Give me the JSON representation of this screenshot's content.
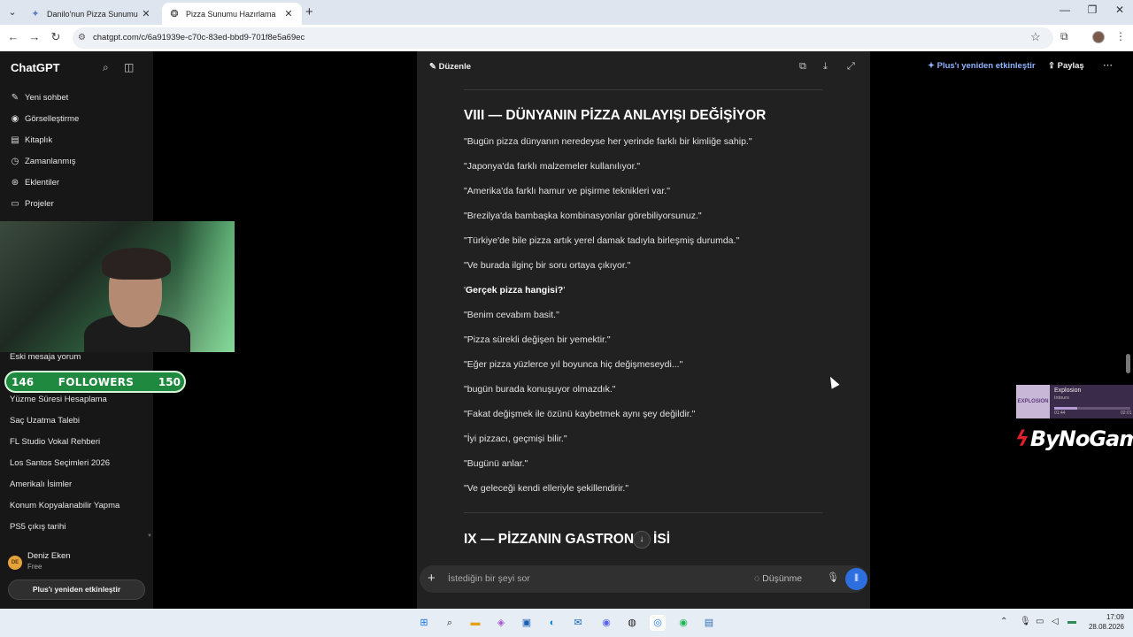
{
  "browser": {
    "tabs": [
      {
        "title": "Danilo'nun Pizza Sunumu - Gem",
        "close": "✕"
      },
      {
        "title": "Pizza Sunumu Hazırlama",
        "close": "✕"
      }
    ],
    "new_tab": "+",
    "url": "chatgpt.com/c/6a91939e-c70c-83ed-bbd9-701f8e5a69ec"
  },
  "sidebar": {
    "brand": "ChatGPT",
    "nav": [
      {
        "label": "Yeni sohbet",
        "icon": "edit-icon"
      },
      {
        "label": "Görselleştirme",
        "icon": "image-icon"
      },
      {
        "label": "Kitaplık",
        "icon": "library-icon"
      },
      {
        "label": "Zamanlanmış",
        "icon": "clock-icon"
      },
      {
        "label": "Eklentiler",
        "icon": "plugin-icon"
      },
      {
        "label": "Projeler",
        "icon": "folder-icon"
      }
    ],
    "chats": [
      "Eski mesaja yorum",
      "Yüzme Süresi Hesaplama",
      "Saç Uzatma Talebi",
      "FL Studio Vokal Rehberi",
      "Los Santos Seçimleri 2026",
      "Amerikalı İsimler",
      "Konum Kopyalanabilir Yapma",
      "PS5 çıkış tarihi"
    ],
    "user": {
      "initials": "DE",
      "name": "Deniz Eken",
      "plan": "Free"
    },
    "upgrade_button": "Plus'ı yeniden etkinleştir"
  },
  "overlay": {
    "followers_current": "146",
    "followers_label": "FOLLOWERS",
    "followers_goal": "150",
    "music": {
      "track": "Explosion",
      "artist": "Intours",
      "elapsed": "01:44",
      "total": "02:01",
      "progress": 0.3,
      "art_text": "EXPLOSION"
    },
    "logo": "ByNoGame"
  },
  "canvas": {
    "edit_label": "Düzenle",
    "section_title": "VIII — DÜNYANIN PİZZA ANLAYIŞI DEĞİŞİYOR",
    "lines": [
      "\"Bugün pizza dünyanın neredeyse her yerinde farklı bir kimliğe sahip.\"",
      "\"Japonya'da farklı malzemeler kullanılıyor.\"",
      "\"Amerika'da farklı hamur ve pişirme teknikleri var.\"",
      "\"Brezilya'da bambaşka kombinasyonlar görebiliyorsunuz.\"",
      "\"Türkiye'de bile pizza artık yerel damak tadıyla birleşmiş durumda.\"",
      "\"Ve burada ilginç bir soru ortaya çıkıyor.\"",
      "\"Benim cevabım basit.\"",
      "\"Pizza sürekli değişen bir yemektir.\"",
      "\"Eğer pizza yüzlerce yıl boyunca hiç değişmeseydi...\"",
      "\"bugün burada konuşuyor olmazdık.\"",
      "\"Fakat değişmek ile özünü kaybetmek aynı şey değildir.\"",
      "\"İyi pizzacı, geçmişi bilir.\"",
      "\"Bugünü anlar.\"",
      "\"Ve geleceği kendi elleriyle şekillendirir.\""
    ],
    "bold_line_prefix": "'",
    "bold_line": "Gerçek pizza hangisi?",
    "bold_line_suffix": "'",
    "next_title": "IX — PİZZANIN GASTRON",
    "next_title_tail": "İSİ",
    "composer_placeholder": "İstediğin bir şeyi sor",
    "think_label": "Düşünme"
  },
  "header": {
    "plus_link": "Plus'ı yeniden etkinleştir",
    "share": "Paylaş"
  },
  "taskbar": {
    "time": "17:09",
    "date": "28.08.2026"
  }
}
